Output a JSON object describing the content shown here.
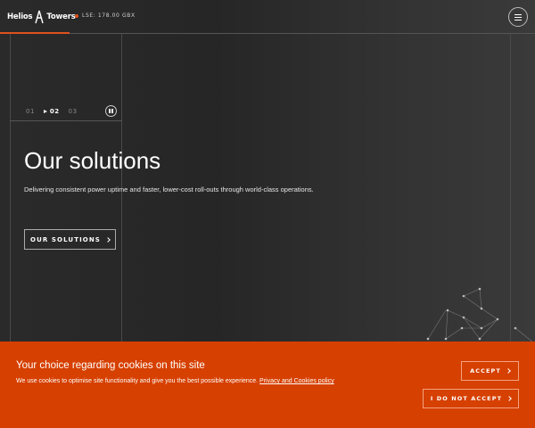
{
  "header": {
    "logo_left": "Helios",
    "logo_right": "Towers",
    "ticker": "LSE: 178.00 GBX",
    "accent_color": "#e0511e"
  },
  "slider": {
    "slides": [
      "01",
      "02",
      "03"
    ],
    "active_index": 1,
    "pause_icon": "pause-icon"
  },
  "hero": {
    "title": "Our solutions",
    "subtitle": "Delivering consistent power uptime and faster, lower-cost roll-outs through world-class operations.",
    "cta_label": "OUR SOLUTIONS"
  },
  "cookie": {
    "title": "Your choice regarding cookies on this site",
    "text": "We use cookies to optimise site functionality and give you the best possible experience.",
    "link_text": "Privacy and Cookies policy",
    "accept_label": "ACCEPT",
    "decline_label": "I DO NOT ACCEPT",
    "background_color": "#d64000"
  }
}
